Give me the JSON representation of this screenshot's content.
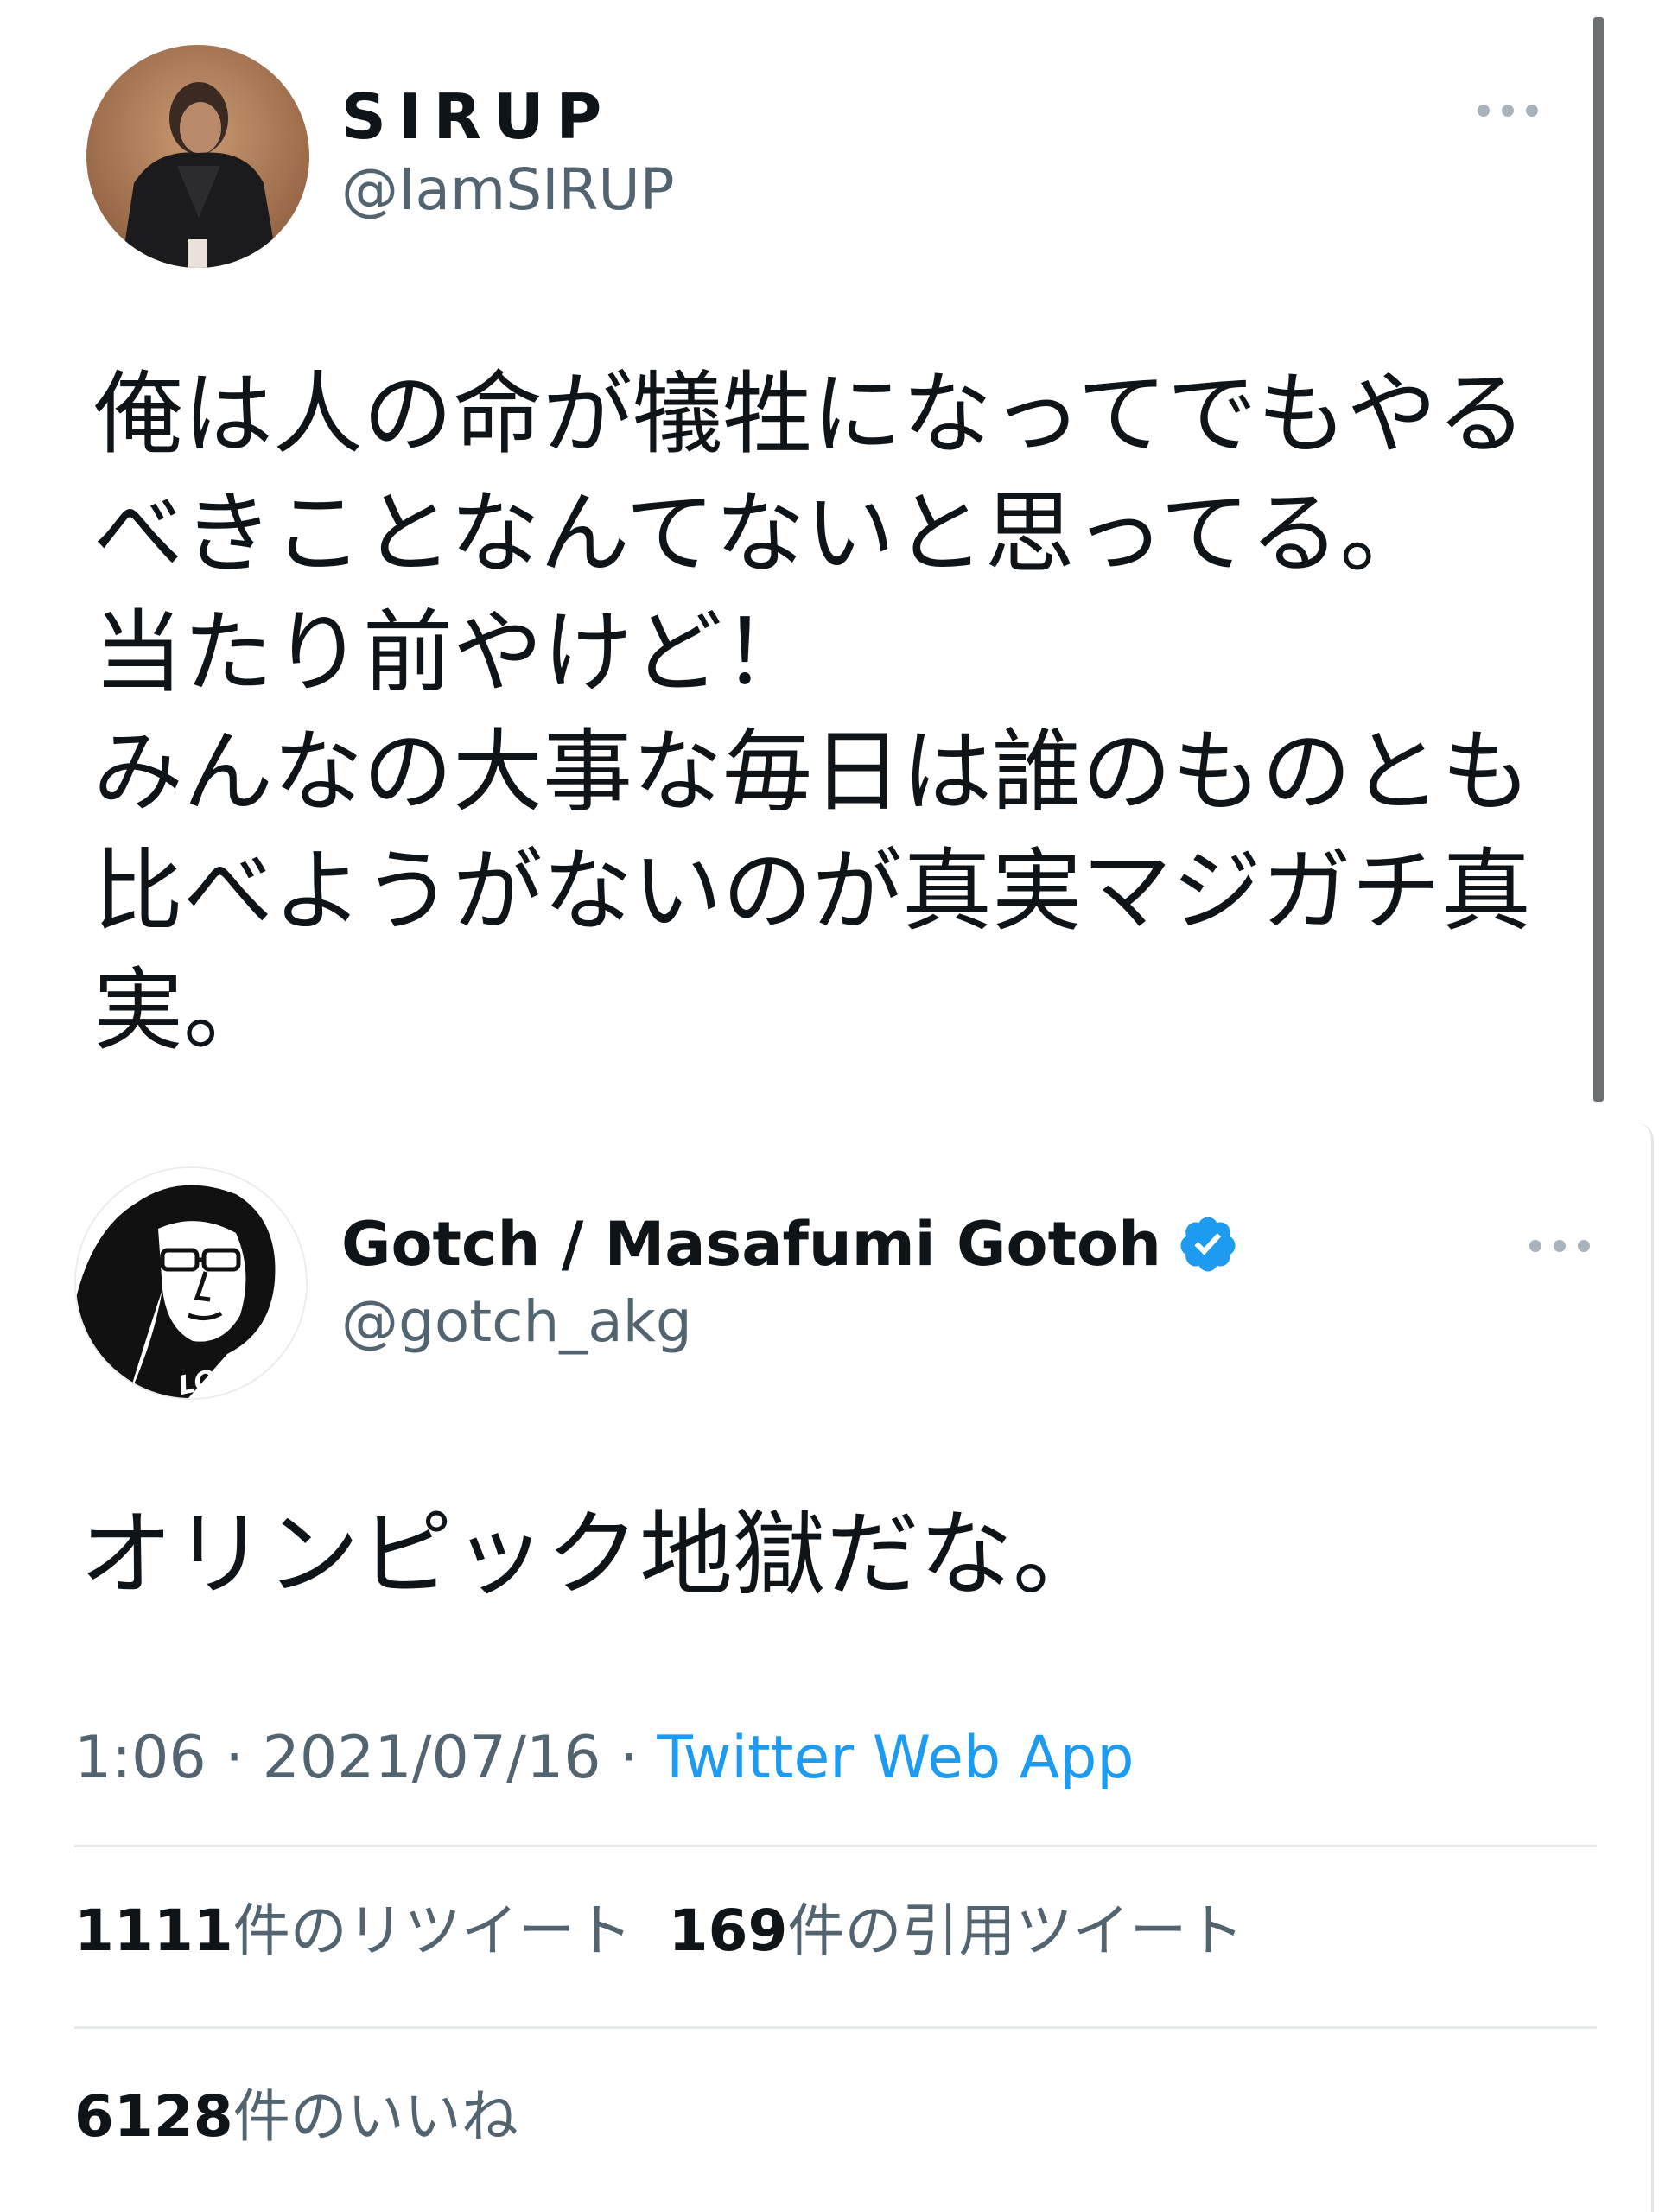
{
  "quoted_tweet": {
    "display_name": "SIRUP",
    "handle": "@IamSIRUP",
    "avatar_icon": "person-photo-avatar",
    "more_icon": "more-options-icon",
    "text": "俺は人の命が犠牲になってでもやる\nべきことなんてないと思ってる。\n当たり前やけど！\nみんなの大事な毎日は誰のものとも\n比べようがないのが真実マジガチ真\n実。"
  },
  "main_tweet": {
    "display_name": "Gotch / Masafumi Gotoh",
    "handle": "@gotch_akg",
    "avatar_icon": "illustrated-face-avatar",
    "avatar_lettering": "LOVE",
    "verified_icon": "verified-badge-icon",
    "text": "オリンピック地獄だな。",
    "time": "1:06",
    "separator": " · ",
    "date": "2021/07/16",
    "source": "Twitter Web App",
    "retweets_count": "1111",
    "retweets_label": "件のリツイート",
    "quotes_count": "169",
    "quotes_label": "件の引用ツイート",
    "likes_count": "6128",
    "likes_label": "件のいいね"
  },
  "colors": {
    "text_primary": "#0f1419",
    "text_secondary": "#536471",
    "link": "#1d9bf0",
    "verified": "#1d9bf0",
    "divider": "#e6e9eb"
  }
}
